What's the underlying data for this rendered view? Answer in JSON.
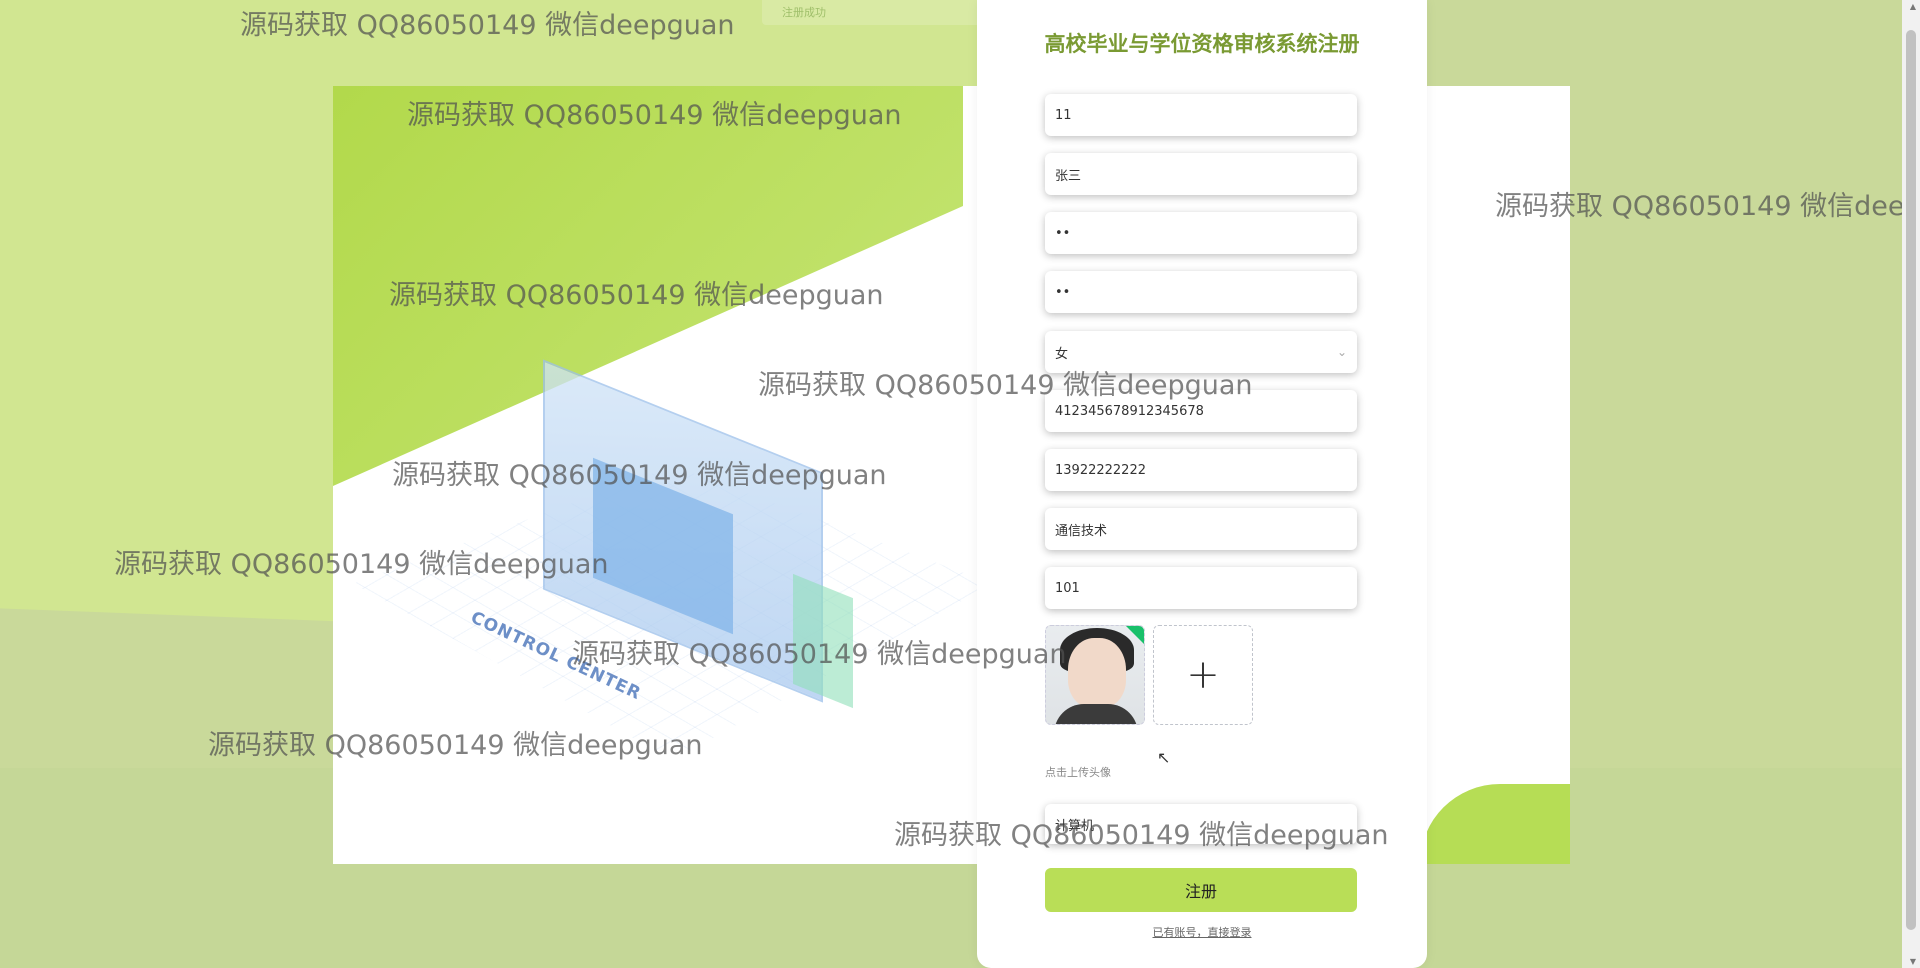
{
  "page": {
    "title": "高校毕业与学位资格审核系统注册",
    "notification": "注册成功"
  },
  "form": {
    "fields": [
      {
        "name": "account",
        "value": "11"
      },
      {
        "name": "name",
        "value": "张三"
      },
      {
        "name": "password",
        "value": "••"
      },
      {
        "name": "confirm-password",
        "value": "••"
      },
      {
        "name": "gender",
        "value": "女"
      },
      {
        "name": "id-card",
        "value": "412345678912345678"
      },
      {
        "name": "phone",
        "value": "13922222222"
      },
      {
        "name": "major",
        "value": "通信技术"
      },
      {
        "name": "class",
        "value": "101"
      }
    ],
    "upload_hint": "点击上传头像",
    "extra_field_value": "计算机",
    "submit_label": "注册",
    "login_link": "已有账号，直接登录"
  },
  "illustration": {
    "label": "CONTROL CENTER"
  },
  "watermark": "源码获取 QQ86050149 微信deepguan",
  "colors": {
    "title": "#7a9a33",
    "accent": "#b9de57",
    "background": "#c9d99a"
  }
}
